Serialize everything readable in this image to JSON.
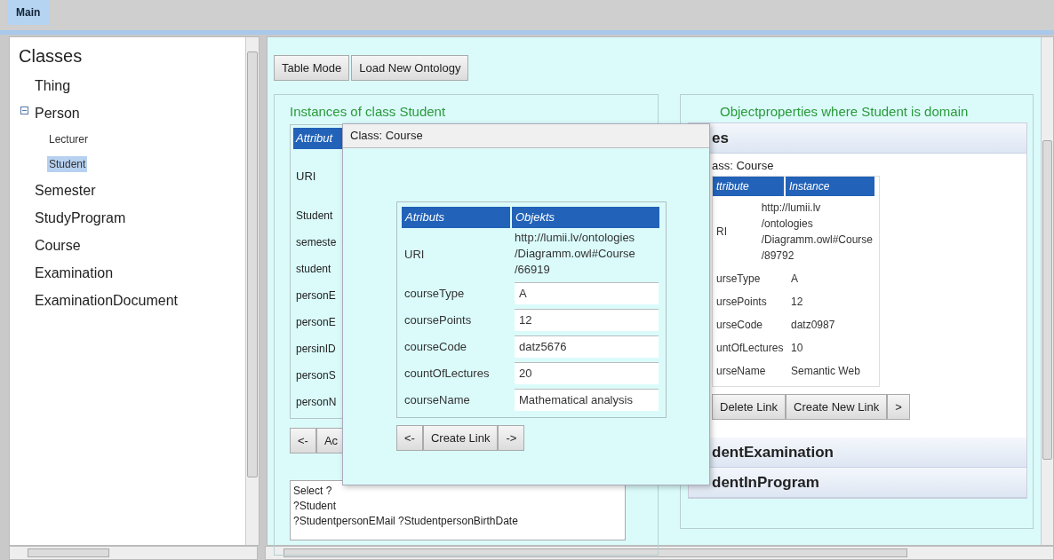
{
  "tabs": [
    {
      "label": "Main",
      "selected": true
    }
  ],
  "sidebar": {
    "title": "Classes",
    "items": [
      {
        "label": "Thing",
        "selected": false
      },
      {
        "label": "Person",
        "selected": false,
        "expanded": true,
        "children": [
          {
            "label": "Lecturer",
            "selected": false
          },
          {
            "label": "Student",
            "selected": true
          }
        ]
      },
      {
        "label": "Semester",
        "selected": false
      },
      {
        "label": "StudyProgram",
        "selected": false
      },
      {
        "label": "Course",
        "selected": false
      },
      {
        "label": "Examination",
        "selected": false
      },
      {
        "label": "ExaminationDocument",
        "selected": false
      }
    ]
  },
  "toolbar": [
    "Table Mode",
    "Load New Ontology"
  ],
  "instances_panel": {
    "title": "Instances of class Student",
    "header": "Attribut",
    "rows": [
      "URI",
      "Student",
      "semeste",
      "student",
      "personE",
      "personE",
      "persinID",
      "personS",
      "personN"
    ],
    "buttons": [
      "<-",
      "Ac"
    ],
    "query_lines": [
      "Select ?",
      "?Student",
      "?StudentpersonEMail ?StudentpersonBirthDate"
    ]
  },
  "objectproperties_panel": {
    "title": "Objectproperties where Student is domain",
    "sections": [
      {
        "label": "es",
        "expanded": true,
        "class_label": "ass: Course",
        "columns": [
          "ttribute",
          "Instance"
        ],
        "rows": [
          {
            "attribute": "RI",
            "instance": "http://lumii.lv\n/ontologies\n/Diagramm.owl#Course\n/89792"
          },
          {
            "attribute": "urseType",
            "instance": "A"
          },
          {
            "attribute": "ursePoints",
            "instance": "12"
          },
          {
            "attribute": "urseCode",
            "instance": "datz0987"
          },
          {
            "attribute": "untOfLectures",
            "instance": "10"
          },
          {
            "attribute": "urseName",
            "instance": "Semantic Web"
          }
        ],
        "buttons": [
          "Delete Link",
          "Create New Link",
          ">"
        ]
      },
      {
        "label": "dentExamination",
        "expanded": false
      },
      {
        "label": "dentInProgram",
        "expanded": false
      }
    ]
  },
  "dialog": {
    "title": "Class: Course",
    "columns": [
      "Atributs",
      "Objekts"
    ],
    "rows": [
      {
        "attribute": "URI",
        "value": "http://lumii.lv/ontologies\n/Diagramm.owl#Course\n/66919",
        "kind": "text"
      },
      {
        "attribute": "courseType",
        "value": "A",
        "kind": "field"
      },
      {
        "attribute": "coursePoints",
        "value": "12",
        "kind": "field"
      },
      {
        "attribute": "courseCode",
        "value": "datz5676",
        "kind": "field"
      },
      {
        "attribute": "countOfLectures",
        "value": "20",
        "kind": "field"
      },
      {
        "attribute": "courseName",
        "value": "Mathematical analysis",
        "kind": "field"
      }
    ],
    "buttons": [
      "<-",
      "Create Link",
      "->"
    ]
  }
}
